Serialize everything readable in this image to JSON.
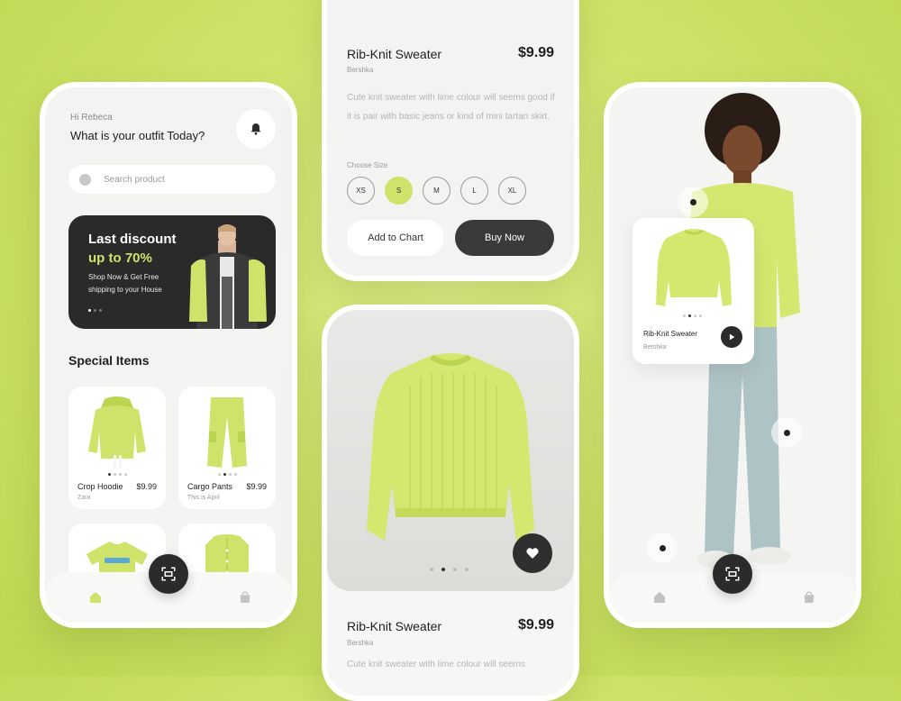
{
  "home": {
    "greeting": "Hi Rebeca",
    "question": "What is your outfit Today?",
    "search_placeholder": "Search product",
    "banner": {
      "title": "Last discount",
      "subtitle": "up to 70%",
      "description": "Shop Now & Get Free shipping to your House"
    },
    "section_title": "Special Items",
    "items": [
      {
        "name": "Crop Hoodie",
        "price": "$9.99",
        "brand": "Zara"
      },
      {
        "name": "Cargo Pants",
        "price": "$9.99",
        "brand": "This is April"
      }
    ]
  },
  "detail_top": {
    "name": "Rib-Knit Sweater",
    "price": "$9.99",
    "brand": "Bershka",
    "description": "Cute knit sweater with lime colour will seems good if it is pair with basic jeans or kind of mini tartan skirt.",
    "size_label": "Choose Size",
    "sizes": [
      "XS",
      "S",
      "M",
      "L",
      "XL"
    ],
    "selected_size": "S",
    "add_to_cart_label": "Add to Chart",
    "buy_now_label": "Buy Now"
  },
  "detail_bottom": {
    "name": "Rib-Knit Sweater",
    "price": "$9.99",
    "brand": "Bershka",
    "description": "Cute knit sweater with lime colour will seems"
  },
  "look": {
    "card_name": "Rib-Knit Sweater",
    "card_brand": "Bershka"
  },
  "colors": {
    "accent": "#cfe36a",
    "dark": "#2b2b2b",
    "surface": "#f3f3f1"
  },
  "icons": [
    "bell-icon",
    "search-icon",
    "home-icon",
    "bag-icon",
    "scan-icon",
    "heart-icon",
    "play-icon"
  ]
}
